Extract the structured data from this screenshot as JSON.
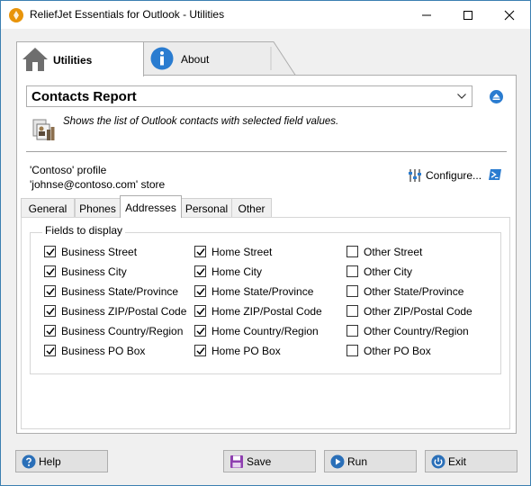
{
  "window": {
    "title": "ReliefJet Essentials for Outlook - Utilities"
  },
  "main_tabs": [
    {
      "label": "Utilities",
      "icon": "home-icon",
      "active": true
    },
    {
      "label": "About",
      "icon": "info-icon",
      "active": false
    }
  ],
  "report": {
    "selected": "Contacts Report",
    "description": "Shows the list of Outlook contacts with selected field values."
  },
  "profile": {
    "line1": "'Contoso' profile",
    "line2": "'johnse@contoso.com' store",
    "configure_label": "Configure..."
  },
  "sub_tabs": [
    {
      "label": "General",
      "active": false
    },
    {
      "label": "Phones",
      "active": false
    },
    {
      "label": "Addresses",
      "active": true
    },
    {
      "label": "Personal",
      "active": false
    },
    {
      "label": "Other",
      "active": false
    }
  ],
  "fields": {
    "legend": "Fields to display",
    "columns": [
      {
        "items": [
          {
            "label": "Business Street",
            "checked": true
          },
          {
            "label": "Business City",
            "checked": true
          },
          {
            "label": "Business State/Province",
            "checked": true
          },
          {
            "label": "Business ZIP/Postal Code",
            "checked": true
          },
          {
            "label": "Business Country/Region",
            "checked": true
          },
          {
            "label": "Business PO Box",
            "checked": true
          }
        ]
      },
      {
        "items": [
          {
            "label": "Home Street",
            "checked": true
          },
          {
            "label": "Home City",
            "checked": true
          },
          {
            "label": "Home State/Province",
            "checked": true
          },
          {
            "label": "Home ZIP/Postal Code",
            "checked": true
          },
          {
            "label": "Home Country/Region",
            "checked": true
          },
          {
            "label": "Home PO Box",
            "checked": true
          }
        ]
      },
      {
        "items": [
          {
            "label": "Other Street",
            "checked": false
          },
          {
            "label": "Other City",
            "checked": false
          },
          {
            "label": "Other State/Province",
            "checked": false
          },
          {
            "label": "Other ZIP/Postal Code",
            "checked": false
          },
          {
            "label": "Other Country/Region",
            "checked": false
          },
          {
            "label": "Other PO Box",
            "checked": false
          }
        ]
      }
    ]
  },
  "buttons": {
    "help": "Help",
    "save": "Save",
    "run": "Run",
    "exit": "Exit"
  },
  "colors": {
    "accent": "#2a7cd0",
    "titlebar_icon": "#e8940a",
    "save_icon": "#8e3fb0"
  }
}
